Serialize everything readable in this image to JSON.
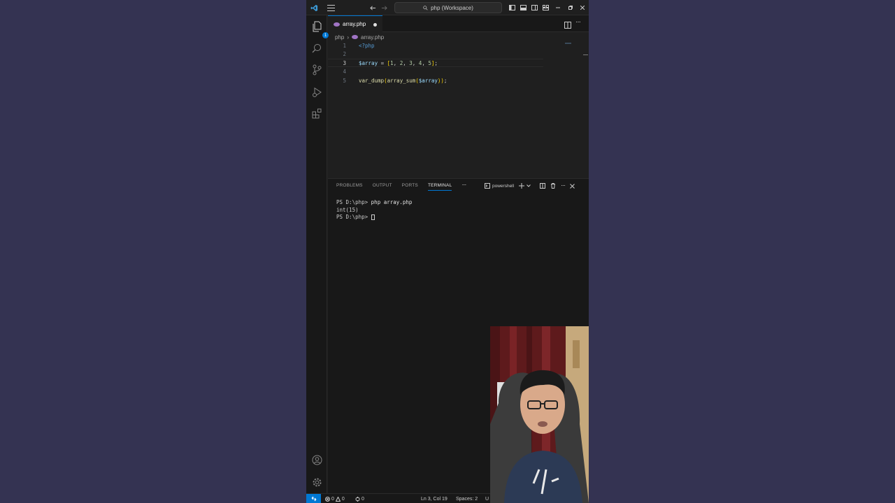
{
  "titlebar": {
    "search_text": "php (Workspace)"
  },
  "activity_bar": {
    "explorer_badge": "1"
  },
  "editor": {
    "tab_label": "array.php",
    "breadcrumb": {
      "folder": "php",
      "file": "array.php"
    },
    "lines": [
      {
        "num": "1",
        "text": "<?php"
      },
      {
        "num": "2",
        "text": ""
      },
      {
        "num": "3",
        "text": "$array = [1, 2, 3, 4, 5];"
      },
      {
        "num": "4",
        "text": ""
      },
      {
        "num": "5",
        "text": "var_dump(array_sum($array));"
      }
    ]
  },
  "panel": {
    "tabs": [
      "PROBLEMS",
      "OUTPUT",
      "PORTS",
      "TERMINAL"
    ],
    "shell_label": "powershell",
    "terminal": {
      "prompt1": "PS D:\\php> ",
      "command": "php array.php",
      "output": "int(15)",
      "prompt2": "PS D:\\php> "
    }
  },
  "statusbar": {
    "errors": "0",
    "warnings": "0",
    "ports": "0",
    "position": "Ln 3, Col 19",
    "spaces": "Spaces: 2",
    "encoding": "U"
  },
  "colors": {
    "accent": "#0078d4",
    "background": "#343352",
    "editor_bg": "#1f1f1f",
    "keyword": "#569cd6",
    "variable": "#9cdcfe",
    "number": "#b5cea8",
    "function": "#dcdcaa",
    "bracket": "#ffd700"
  }
}
